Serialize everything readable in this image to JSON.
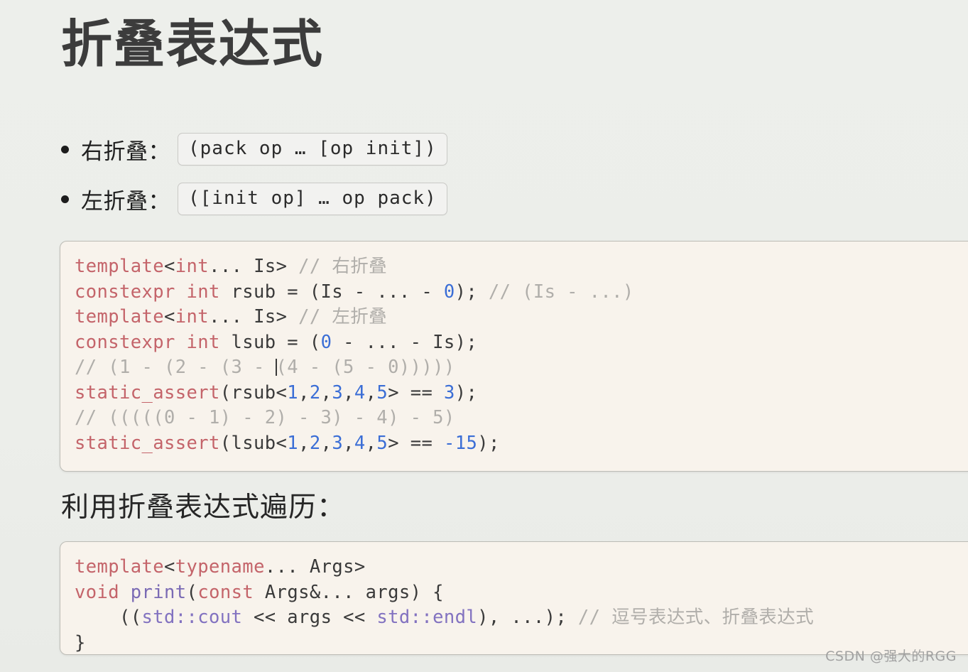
{
  "page": {
    "title": "折叠表达式",
    "background_color": "#eceeea",
    "mid_heading": "利用折叠表达式遍历：",
    "watermark": "CSDN @强大的RGG"
  },
  "bullets": [
    {
      "label": "右折叠：",
      "code": "(pack op … [op init])"
    },
    {
      "label": "左折叠：",
      "code": "([init op] … op pack)"
    }
  ],
  "code_blocks": [
    {
      "id": "code-block-1",
      "background_color": "#f8f3ec",
      "lines": [
        "template<int... Is> // 右折叠",
        "constexpr int rsub = (Is - ... - 0); // (Is - ...)",
        "template<int... Is> // 左折叠",
        "constexpr int lsub = (0 - ... - Is);",
        "// (1 - (2 - (3 - (4 - (5 - 0)))))",
        "static_assert(rsub<1,2,3,4,5> == 3);",
        "// (((((0 - 1) - 2) - 3) - 4) - 5)",
        "static_assert(lsub<1,2,3,4,5> == -15);"
      ]
    },
    {
      "id": "code-block-2",
      "background_color": "#f8f3ec",
      "lines": [
        "template<typename... Args>",
        "void print(const Args&... args) {",
        "    ((std::cout << args << std::endl), ...); // 逗号表达式、折叠表达式",
        "}"
      ]
    }
  ],
  "syntax_colors": {
    "keyword": "#c4646a",
    "function": "#7a6ab4",
    "number": "#3b6ed6",
    "comment": "#b0aeaa",
    "namespace": "#8272c0",
    "identifier": "#3a3a3a"
  }
}
